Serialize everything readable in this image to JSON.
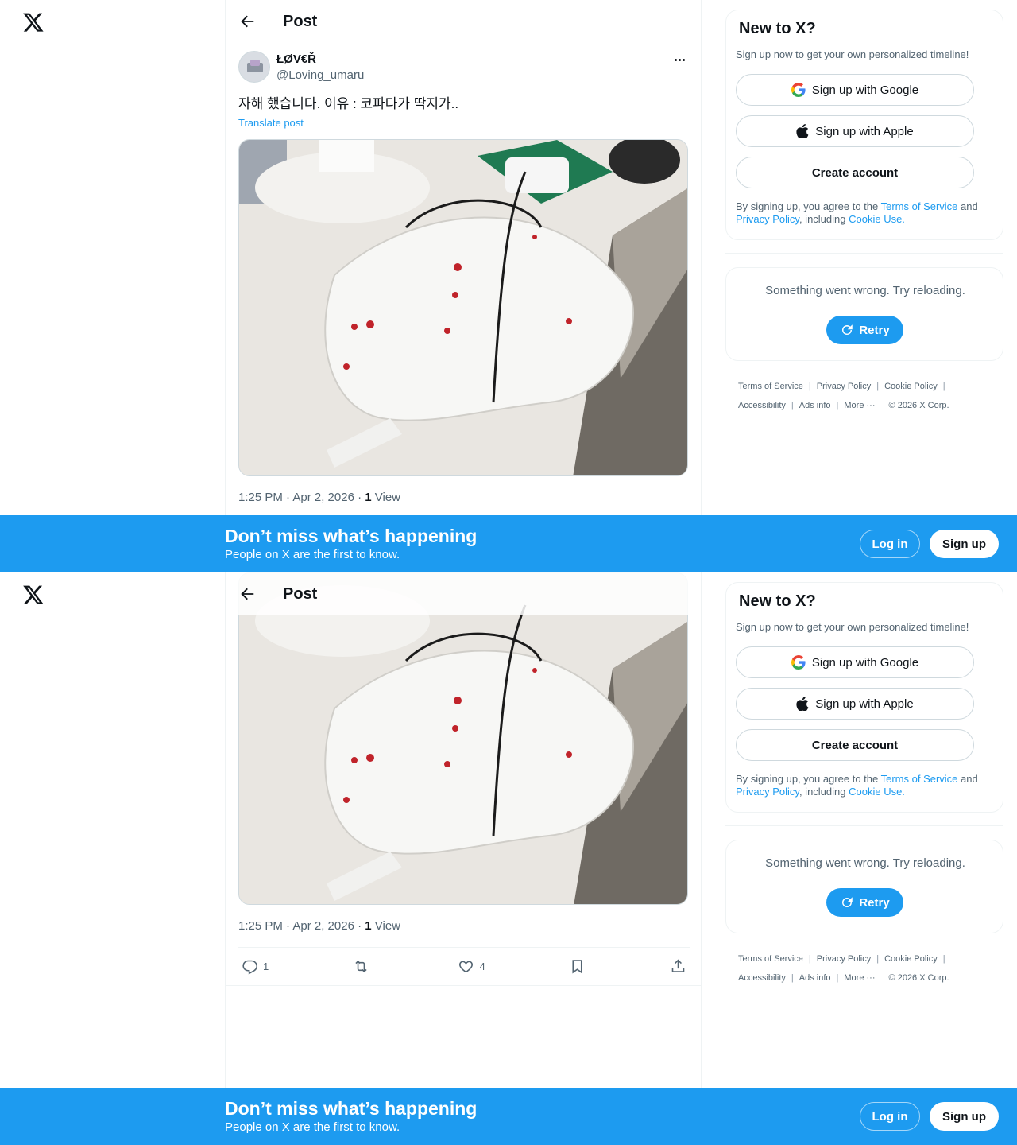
{
  "header": {
    "title": "Post"
  },
  "post": {
    "display_name": "ŁØV€Ř",
    "handle": "@Loving_umaru",
    "text": "자해 했습니다. 이유 : 코파다가 딱지가..",
    "translate_label": "Translate post",
    "time": "1:25 PM · Apr 2, 2026 · ",
    "views_count": "1",
    "views_label": " View",
    "image_icon": "photo"
  },
  "actions": {
    "replies": "1",
    "reposts": "",
    "likes": "4"
  },
  "sidebar": {
    "signup_title": "New to X?",
    "signup_sub": "Sign up now to get your own personalized timeline!",
    "google_label": "Sign up with Google",
    "apple_label": "Sign up with Apple",
    "create_label": "Create account",
    "legal_pre": "By signing up, you agree to the ",
    "terms_link": "Terms of Service",
    "legal_and": " and ",
    "privacy_link": "Privacy Policy",
    "legal_mid": ", including ",
    "cookie_link": "Cookie Use.",
    "error_text": "Something went wrong. Try reloading.",
    "retry_label": "Retry"
  },
  "footer": {
    "terms": "Terms of Service",
    "privacy": "Privacy Policy",
    "cookie": "Cookie Policy",
    "accessibility": "Accessibility",
    "ads": "Ads info",
    "more": "More ···",
    "copyright": "© 2026 X Corp."
  },
  "banner": {
    "headline": "Don’t miss what’s happening",
    "sub": "People on X are the first to know.",
    "login": "Log in",
    "signup": "Sign up"
  },
  "colors": {
    "accent": "#1d9bf0",
    "text": "#0f1419",
    "muted": "#536471"
  }
}
